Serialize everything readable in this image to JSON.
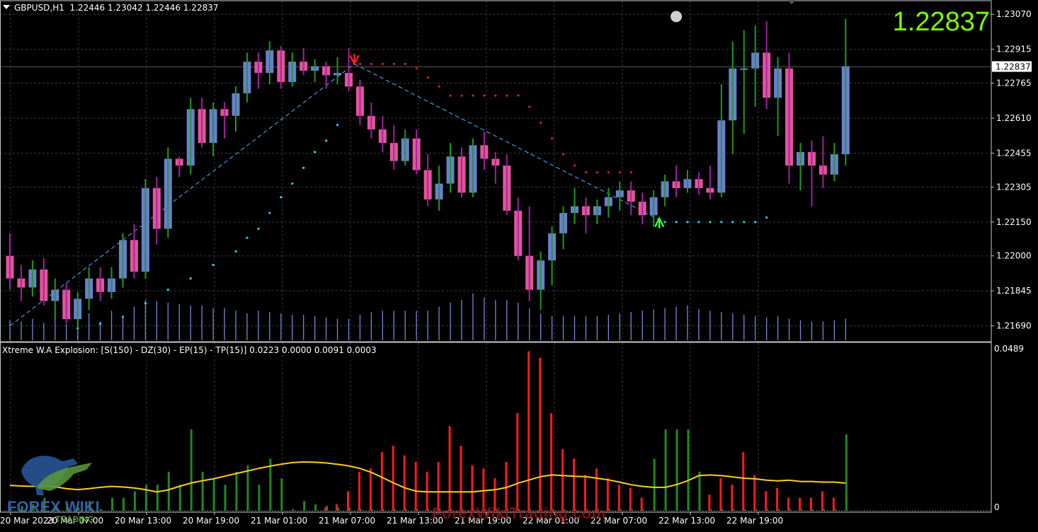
{
  "chart_header": {
    "symbol": "GBPUSD,H1",
    "open": "1.22446",
    "high": "1.23042",
    "low": "1.22446",
    "close": "1.22837"
  },
  "big_price": "1.22837",
  "current_price_label": "1.22837",
  "indicator_label": "Xtreme W.A Explosion: [S(150) - DZ(30) - EP(15) - TP(15)] 0.0223 0.0000 0.0091 0.0003",
  "price_axis": [
    "1.23070",
    "1.22915",
    "1.22765",
    "1.22610",
    "1.22455",
    "1.22305",
    "1.22150",
    "1.22000",
    "1.21845",
    "1.21690"
  ],
  "indicator_axis": [
    "0.0489",
    "0"
  ],
  "time_axis": [
    "20 Mar 2023",
    "20 Mar 07:00",
    "20 Mar 13:00",
    "20 Mar 19:00",
    "21 Mar 01:00",
    "21 Mar 07:00",
    "21 Mar 13:00",
    "21 Mar 19:00",
    "22 Mar 01:00",
    "22 Mar 07:00",
    "22 Mar 13:00",
    "22 Mar 19:00"
  ],
  "watermark": {
    "logo_text": "FOREX WIKI",
    "logo_sub": "TRADING",
    "site": "ForexWikiTrading.com"
  },
  "colors": {
    "bull_body": "#6a7fd0",
    "bear_body": "#e2559b",
    "wick_bull": "#1e9a1e",
    "wick_bear": "#a020a0",
    "grid": "#3a3a3a",
    "hist_green": "#1f8a1f",
    "hist_red": "#ff1a1a",
    "signal_line": "#ffcc22",
    "cyan_dots": "#33ccff",
    "red_dots": "#ff2020",
    "big_price": "#7CFC00"
  },
  "chart_data": [
    {
      "type": "candlestick",
      "ylim": [
        1.2162,
        1.2313
      ],
      "candles": [
        [
          1.22,
          1.221,
          1.2185,
          1.219
        ],
        [
          1.219,
          1.2196,
          1.218,
          1.2186
        ],
        [
          1.2186,
          1.2198,
          1.2182,
          1.2194
        ],
        [
          1.2194,
          1.2199,
          1.2178,
          1.218
        ],
        [
          1.218,
          1.219,
          1.2172,
          1.2185
        ],
        [
          1.2185,
          1.2188,
          1.217,
          1.2172
        ],
        [
          1.2172,
          1.2184,
          1.2168,
          1.2181
        ],
        [
          1.2181,
          1.2195,
          1.2176,
          1.219
        ],
        [
          1.219,
          1.2195,
          1.218,
          1.2184
        ],
        [
          1.2184,
          1.2195,
          1.2181,
          1.219
        ],
        [
          1.219,
          1.221,
          1.2186,
          1.2207
        ],
        [
          1.2207,
          1.2214,
          1.219,
          1.2193
        ],
        [
          1.2193,
          1.2234,
          1.219,
          1.223
        ],
        [
          1.223,
          1.2235,
          1.2205,
          1.2212
        ],
        [
          1.2212,
          1.2248,
          1.2208,
          1.2243
        ],
        [
          1.2243,
          1.2244,
          1.2235,
          1.224
        ],
        [
          1.224,
          1.227,
          1.2236,
          1.2265
        ],
        [
          1.2265,
          1.227,
          1.2248,
          1.225
        ],
        [
          1.225,
          1.2268,
          1.2244,
          1.2265
        ],
        [
          1.2265,
          1.2268,
          1.2252,
          1.2262
        ],
        [
          1.2262,
          1.2275,
          1.2255,
          1.2272
        ],
        [
          1.2272,
          1.229,
          1.2268,
          1.2286
        ],
        [
          1.2286,
          1.229,
          1.2274,
          1.2281
        ],
        [
          1.2281,
          1.2295,
          1.2276,
          1.2291
        ],
        [
          1.2291,
          1.2293,
          1.2274,
          1.2277
        ],
        [
          1.2277,
          1.229,
          1.2275,
          1.2286
        ],
        [
          1.2286,
          1.2292,
          1.228,
          1.2282
        ],
        [
          1.2282,
          1.2287,
          1.2277,
          1.2284
        ],
        [
          1.2284,
          1.2286,
          1.2274,
          1.228
        ],
        [
          1.228,
          1.2288,
          1.2276,
          1.2281
        ],
        [
          1.2281,
          1.2292,
          1.2273,
          1.2275
        ],
        [
          1.2275,
          1.2278,
          1.2258,
          1.2262
        ],
        [
          1.2262,
          1.2268,
          1.2252,
          1.2256
        ],
        [
          1.2256,
          1.2262,
          1.2246,
          1.225
        ],
        [
          1.225,
          1.2258,
          1.2238,
          1.2242
        ],
        [
          1.2242,
          1.2256,
          1.224,
          1.2252
        ],
        [
          1.2252,
          1.2256,
          1.2236,
          1.2238
        ],
        [
          1.2238,
          1.2245,
          1.2222,
          1.2225
        ],
        [
          1.2225,
          1.224,
          1.222,
          1.2232
        ],
        [
          1.2232,
          1.225,
          1.2228,
          1.2244
        ],
        [
          1.2244,
          1.2248,
          1.2226,
          1.2228
        ],
        [
          1.2228,
          1.2252,
          1.2226,
          1.2249
        ],
        [
          1.2249,
          1.2255,
          1.2238,
          1.2243
        ],
        [
          1.2243,
          1.2246,
          1.2232,
          1.224
        ],
        [
          1.224,
          1.2245,
          1.2218,
          1.222
        ],
        [
          1.222,
          1.2226,
          1.2198,
          1.22
        ],
        [
          1.22,
          1.2222,
          1.218,
          1.2185
        ],
        [
          1.2185,
          1.2202,
          1.2176,
          1.2198
        ],
        [
          1.2198,
          1.2213,
          1.2187,
          1.221
        ],
        [
          1.221,
          1.2222,
          1.2203,
          1.2219
        ],
        [
          1.2219,
          1.223,
          1.2214,
          1.2222
        ],
        [
          1.2222,
          1.2226,
          1.221,
          1.2218
        ],
        [
          1.2218,
          1.2225,
          1.2214,
          1.2222
        ],
        [
          1.2222,
          1.223,
          1.2217,
          1.2226
        ],
        [
          1.2226,
          1.2233,
          1.222,
          1.2229
        ],
        [
          1.2229,
          1.2233,
          1.2218,
          1.2224
        ],
        [
          1.2224,
          1.2228,
          1.2214,
          1.2218
        ],
        [
          1.2218,
          1.2229,
          1.2213,
          1.2226
        ],
        [
          1.2226,
          1.2236,
          1.2222,
          1.2233
        ],
        [
          1.2233,
          1.224,
          1.2226,
          1.223
        ],
        [
          1.223,
          1.2238,
          1.2228,
          1.2234
        ],
        [
          1.2234,
          1.2237,
          1.2227,
          1.223
        ],
        [
          1.223,
          1.224,
          1.2225,
          1.2228
        ],
        [
          1.2228,
          1.2276,
          1.2226,
          1.226
        ],
        [
          1.226,
          1.2295,
          1.2245,
          1.2283
        ],
        [
          1.2283,
          1.23,
          1.2254,
          1.2283
        ],
        [
          1.2283,
          1.2302,
          1.2266,
          1.229
        ],
        [
          1.229,
          1.2304,
          1.2265,
          1.227
        ],
        [
          1.227,
          1.2288,
          1.2253,
          1.2283
        ],
        [
          1.2283,
          1.229,
          1.2232,
          1.224
        ],
        [
          1.224,
          1.225,
          1.2229,
          1.2246
        ],
        [
          1.2246,
          1.2251,
          1.2222,
          1.224
        ],
        [
          1.224,
          1.2253,
          1.223,
          1.2236
        ],
        [
          1.2236,
          1.225,
          1.2233,
          1.2245
        ],
        [
          1.2245,
          1.2305,
          1.224,
          1.2284
        ]
      ],
      "zigzag": [
        [
          1.2169,
          0
        ],
        [
          1.2285,
          30.5
        ],
        [
          1.2216,
          57.5
        ]
      ],
      "arrows": [
        {
          "dir": "down",
          "i": 30.5,
          "price": 1.2285
        },
        {
          "dir": "up",
          "i": 57.5,
          "price": 1.2216
        }
      ],
      "circle_marker": {
        "i": 59,
        "price": 1.2306
      },
      "cyan_dots": [
        [
          6,
          1.2168
        ],
        [
          8,
          1.217
        ],
        [
          10,
          1.2173
        ],
        [
          12,
          1.2179
        ],
        [
          14,
          1.2185
        ],
        [
          16,
          1.219
        ],
        [
          18,
          1.2196
        ],
        [
          20,
          1.2202
        ],
        [
          21,
          1.2208
        ],
        [
          22,
          1.2212
        ],
        [
          23,
          1.2219
        ],
        [
          24,
          1.2226
        ],
        [
          25,
          1.2232
        ],
        [
          26,
          1.2239
        ],
        [
          27,
          1.2246
        ],
        [
          28,
          1.2251
        ],
        [
          29,
          1.2258
        ],
        [
          58,
          1.2215
        ],
        [
          59,
          1.2215
        ],
        [
          60,
          1.2215
        ],
        [
          61,
          1.2215
        ],
        [
          62,
          1.2215
        ],
        [
          63,
          1.2215
        ],
        [
          64,
          1.2215
        ],
        [
          65,
          1.2215
        ],
        [
          66,
          1.2215
        ],
        [
          67,
          1.2217
        ]
      ],
      "red_dots": [
        [
          31,
          1.2285
        ],
        [
          32,
          1.2285
        ],
        [
          33,
          1.2285
        ],
        [
          34,
          1.2285
        ],
        [
          35,
          1.2285
        ],
        [
          36,
          1.2283
        ],
        [
          37,
          1.2279
        ],
        [
          38,
          1.2275
        ],
        [
          39,
          1.2271
        ],
        [
          40,
          1.2271
        ],
        [
          41,
          1.2271
        ],
        [
          42,
          1.2271
        ],
        [
          43,
          1.2271
        ],
        [
          44,
          1.2271
        ],
        [
          45,
          1.2271
        ],
        [
          46,
          1.2266
        ],
        [
          47,
          1.2259
        ],
        [
          48,
          1.2252
        ],
        [
          49,
          1.2245
        ],
        [
          50,
          1.224
        ],
        [
          51,
          1.2237
        ],
        [
          52,
          1.2237
        ],
        [
          53,
          1.2237
        ],
        [
          54,
          1.2237
        ],
        [
          55,
          1.2237
        ]
      ],
      "volumes": [
        15,
        14,
        16,
        13,
        18,
        12,
        15,
        20,
        14,
        22,
        17,
        25,
        30,
        29,
        28,
        27,
        26,
        26,
        24,
        24,
        22,
        20,
        22,
        21,
        20,
        19,
        19,
        18,
        17,
        16,
        16,
        19,
        21,
        22,
        22,
        22,
        22,
        22,
        25,
        28,
        30,
        35,
        32,
        30,
        30,
        28,
        24,
        20,
        18,
        18,
        18,
        18,
        18,
        19,
        20,
        21,
        22,
        23,
        24,
        25,
        26,
        23,
        22,
        21,
        20,
        19,
        18,
        17,
        18,
        16,
        15,
        14,
        14,
        15,
        16
      ]
    },
    {
      "type": "bar",
      "ylim": [
        0,
        0.0489
      ],
      "green": [
        0.0005,
        0.0015,
        0.002,
        0.004,
        0.001,
        0.002,
        0.001,
        0.003,
        0.0005,
        0.004,
        0.004,
        0.006,
        0.008,
        0.008,
        0.012,
        0.008,
        0.025,
        0.012,
        0.01,
        0.008,
        0.012,
        0.014,
        0.008,
        0.016,
        0.01,
        0.0005,
        0.003,
        0.002,
        0.0015,
        0.001,
        0.001,
        0.0005,
        0.0005,
        0.0005,
        0.0005,
        0.0005,
        0.0005,
        0.0005,
        0.0005,
        0.0005,
        0.0005,
        0.0005,
        0.0005,
        0.0005,
        0.0005,
        0.0005,
        0.0005,
        0.0005,
        0.0005,
        0.0005,
        0.0005,
        0.0005,
        0.0005,
        0.0005,
        0.0005,
        0.0005,
        0.0005,
        0.016,
        0.025,
        0.025,
        0.025,
        0.012,
        0.0005,
        0.0005,
        0.0005,
        0.0005,
        0.0005,
        0.0005,
        0.0005,
        0.0005,
        0.0005,
        0.0005,
        0.0005,
        0.0005,
        0.0235
      ],
      "red": [
        0,
        0,
        0,
        0,
        0,
        0,
        0,
        0,
        0,
        0,
        0,
        0,
        0,
        0,
        0,
        0,
        0,
        0,
        0,
        0,
        0,
        0,
        0,
        0,
        0,
        0,
        0,
        0,
        0.001,
        0.002,
        0.006,
        0.012,
        0.013,
        0.018,
        0.02,
        0.017,
        0.015,
        0.012,
        0.015,
        0.026,
        0.02,
        0.014,
        0.013,
        0.01,
        0.015,
        0.03,
        0.049,
        0.047,
        0.03,
        0.019,
        0.016,
        0.011,
        0.013,
        0.01,
        0.008,
        0.007,
        0.004,
        0,
        0,
        0,
        0,
        0,
        0.005,
        0.01,
        0.008,
        0.018,
        0.011,
        0.006,
        0.007,
        0.004,
        0.004,
        0.004,
        0.006,
        0.004,
        0
      ],
      "signal": [
        0.0078,
        0.0076,
        0.0075,
        0.0076,
        0.0074,
        0.0068,
        0.0065,
        0.0068,
        0.0072,
        0.0075,
        0.0073,
        0.007,
        0.0065,
        0.0058,
        0.0064,
        0.0075,
        0.0085,
        0.0092,
        0.0098,
        0.0106,
        0.0114,
        0.0122,
        0.013,
        0.0137,
        0.0143,
        0.0148,
        0.015,
        0.0149,
        0.0147,
        0.0143,
        0.0138,
        0.013,
        0.0118,
        0.0102,
        0.0085,
        0.007,
        0.006,
        0.0058,
        0.0058,
        0.0058,
        0.0058,
        0.0058,
        0.0062,
        0.0065,
        0.0072,
        0.0085,
        0.0095,
        0.0105,
        0.011,
        0.0108,
        0.0106,
        0.0105,
        0.01,
        0.0095,
        0.0088,
        0.008,
        0.0075,
        0.0072,
        0.0072,
        0.008,
        0.0092,
        0.0108,
        0.011,
        0.0108,
        0.0104,
        0.01,
        0.0098,
        0.0094,
        0.0092,
        0.0094,
        0.009,
        0.009,
        0.0088,
        0.0088,
        0.0085
      ]
    }
  ]
}
